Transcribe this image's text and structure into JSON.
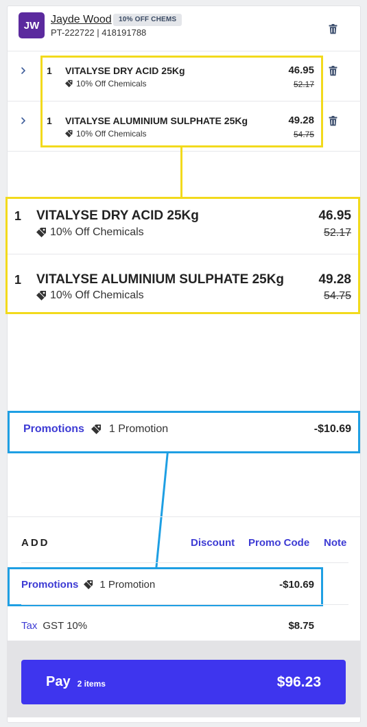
{
  "customer": {
    "initials": "JW",
    "name": "Jayde Wood",
    "badge": "10% OFF CHEMS",
    "id_line": "PT-222722 | 418191788"
  },
  "items": [
    {
      "qty": "1",
      "name": "VITALYSE DRY ACID 25Kg",
      "discount_label": "10% Off Chemicals",
      "price": "46.95",
      "original_price": "52.17"
    },
    {
      "qty": "1",
      "name": "VITALYSE ALUMINIUM SULPHATE 25Kg",
      "discount_label": "10% Off Chemicals",
      "price": "49.28",
      "original_price": "54.75"
    }
  ],
  "promotions": {
    "label": "Promotions",
    "count_text": "1 Promotion",
    "amount": "-$10.69"
  },
  "add": {
    "title": "ADD",
    "discount": "Discount",
    "promo_code": "Promo Code",
    "note": "Note"
  },
  "tax": {
    "label": "Tax",
    "desc": "GST 10%",
    "amount": "$8.75"
  },
  "pay": {
    "label": "Pay",
    "count": "2 items",
    "total": "$96.23"
  },
  "colors": {
    "accent": "#3e35ee",
    "link": "#3d3bd4",
    "avatar": "#5b2a9e",
    "highlight_yellow": "#f2da1c",
    "highlight_blue": "#1e9fe3"
  },
  "icons": {
    "delete": "trash-icon",
    "expand": "chevron-right-icon",
    "discount": "tag-icon"
  }
}
